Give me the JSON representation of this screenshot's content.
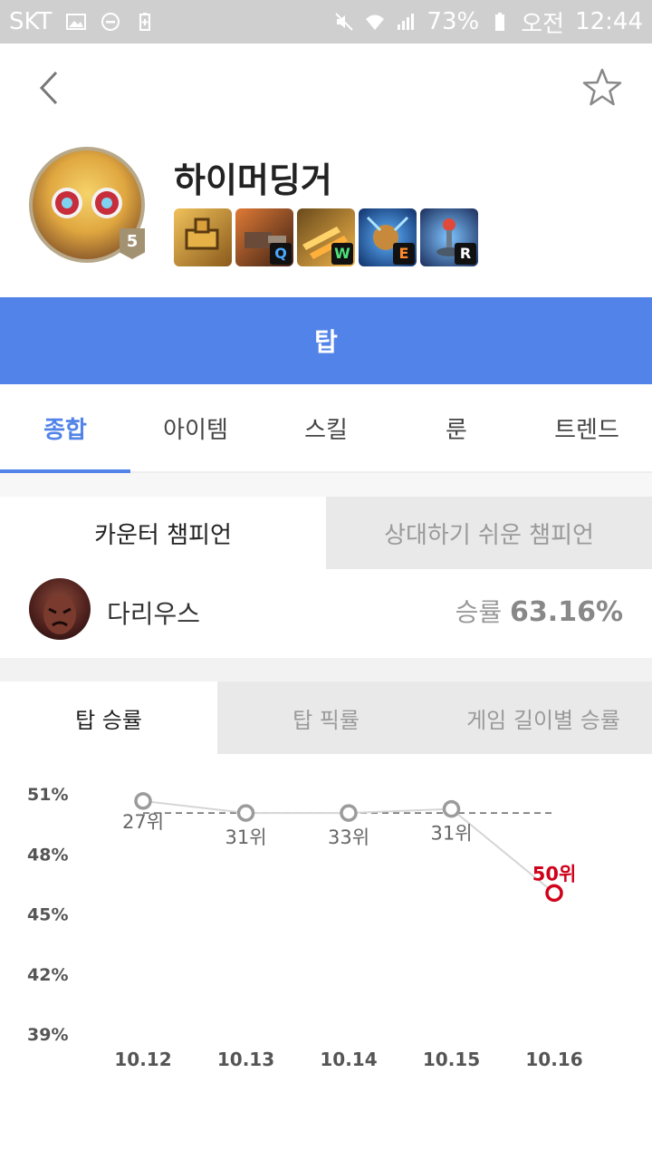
{
  "status_bar": {
    "carrier": "SKT",
    "battery": "73%",
    "ampm": "오전",
    "time": "12:44"
  },
  "header": {
    "back_icon": "chevron-left-icon",
    "favorite_icon": "star-outline-icon"
  },
  "champion": {
    "name": "하이머딩거",
    "level": "5",
    "skills": [
      {
        "key": "",
        "icon": "passive-turret-icon",
        "color": "#c9952f"
      },
      {
        "key": "Q",
        "icon": "turret-q-icon",
        "color": "#b5542a"
      },
      {
        "key": "W",
        "icon": "rockets-w-icon",
        "color": "#d99a3a"
      },
      {
        "key": "E",
        "icon": "grenade-e-icon",
        "color": "#2f6fc4"
      },
      {
        "key": "R",
        "icon": "upgrade-r-icon",
        "color": "#3b5fa8"
      }
    ]
  },
  "role": "탑",
  "tabs": [
    "종합",
    "아이템",
    "스킬",
    "룬",
    "트렌드"
  ],
  "counter": {
    "tabs": [
      "카운터 챔피언",
      "상대하기 쉬운 챔피언"
    ],
    "champion": "다리우스",
    "rate_label": "승률",
    "rate_value": "63.16%"
  },
  "stat_tabs": [
    "탑 승률",
    "탑 픽률",
    "게임 길이별 승률"
  ],
  "colors": {
    "accent": "#5283e8",
    "highlight": "#d0021b",
    "point": "#9b9b9b"
  },
  "chart_data": {
    "type": "line",
    "x": [
      "10.12",
      "10.13",
      "10.14",
      "10.15",
      "10.16"
    ],
    "series": [
      {
        "values": [
          50.6,
          50.0,
          50.0,
          50.2,
          46.0
        ]
      }
    ],
    "point_labels": [
      "27위",
      "31위",
      "33위",
      "31위",
      "50위"
    ],
    "highlight_index": 4,
    "average_line": 50.0,
    "yticks": [
      "51%",
      "48%",
      "45%",
      "42%",
      "39%"
    ],
    "ylim": [
      39,
      51
    ],
    "grid": false
  }
}
